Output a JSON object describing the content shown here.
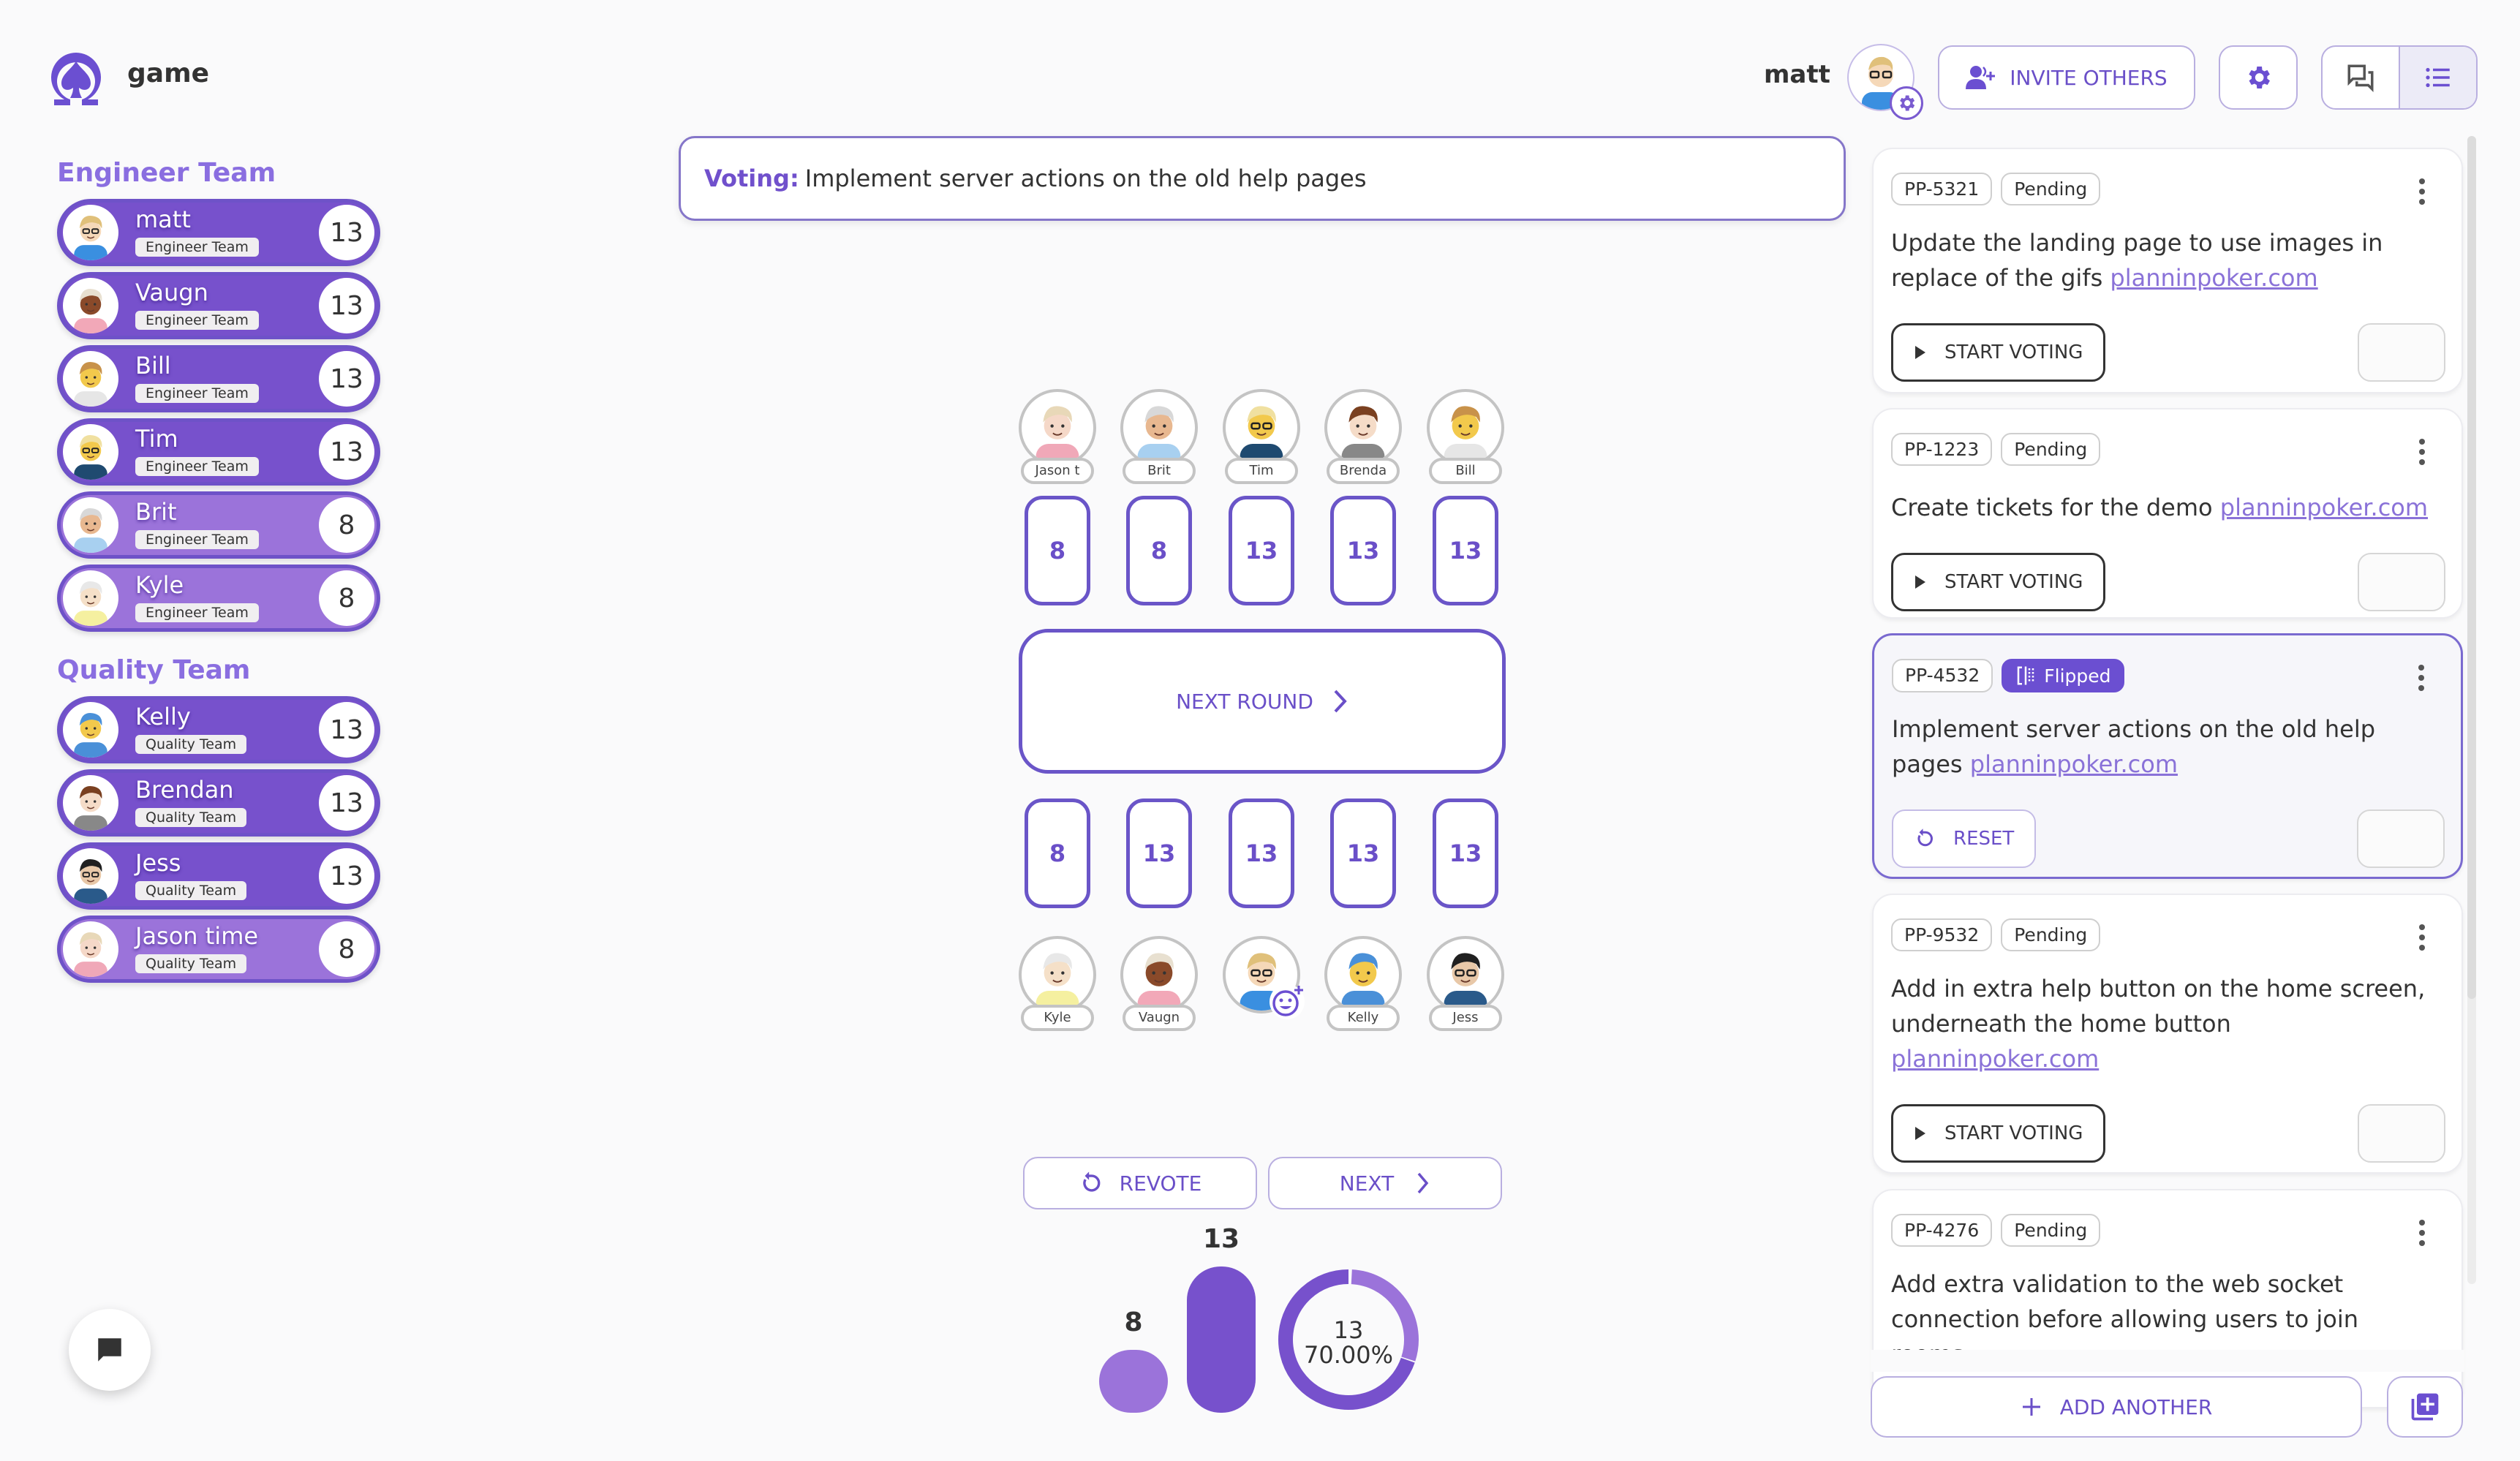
{
  "app": {
    "title": "game",
    "logo_icon": "spade-logo-icon"
  },
  "header": {
    "user_name": "matt",
    "invite_label": "INVITE OTHERS",
    "icons": {
      "invite": "person-add-icon",
      "settings": "gear-icon",
      "chat_view": "chat-bubbles-icon",
      "list_view": "list-icon"
    }
  },
  "colors": {
    "accent": "#6b4fd1",
    "row_voted_majority": "#7751cc",
    "row_voted_minority": "#9b73da",
    "link": "#8a72d8",
    "team_header": "#8a6ee0"
  },
  "sidebar": {
    "teams": [
      {
        "name": "Engineer Team",
        "players": [
          {
            "name": "matt",
            "team": "Engineer Team",
            "vote": "13"
          },
          {
            "name": "Vaugn",
            "team": "Engineer Team",
            "vote": "13"
          },
          {
            "name": "Bill",
            "team": "Engineer Team",
            "vote": "13"
          },
          {
            "name": "Tim",
            "team": "Engineer Team",
            "vote": "13"
          },
          {
            "name": "Brit",
            "team": "Engineer Team",
            "vote": "8"
          },
          {
            "name": "Kyle",
            "team": "Engineer Team",
            "vote": "8"
          }
        ]
      },
      {
        "name": "Quality Team",
        "players": [
          {
            "name": "Kelly",
            "team": "Quality Team",
            "vote": "13"
          },
          {
            "name": "Brendan",
            "team": "Quality Team",
            "vote": "13"
          },
          {
            "name": "Jess",
            "team": "Quality Team",
            "vote": "13"
          },
          {
            "name": "Jason time",
            "team": "Quality Team",
            "vote": "8"
          }
        ]
      }
    ]
  },
  "voting": {
    "label": "Voting:",
    "story": "Implement server actions on the old help pages"
  },
  "table": {
    "top_seats": [
      {
        "name": "Jason t",
        "card": "8"
      },
      {
        "name": "Brit",
        "card": "8"
      },
      {
        "name": "Tim",
        "card": "13"
      },
      {
        "name": "Brenda",
        "card": "13"
      },
      {
        "name": "Bill",
        "card": "13"
      }
    ],
    "bottom_seats": [
      {
        "name": "Kyle",
        "card": "8"
      },
      {
        "name": "Vaugn",
        "card": "13"
      },
      {
        "name": "",
        "card": "13",
        "is_self": true
      },
      {
        "name": "Kelly",
        "card": "13"
      },
      {
        "name": "Jess",
        "card": "13"
      }
    ],
    "next_round_label": "NEXT ROUND"
  },
  "controls": {
    "revote_label": "REVOTE",
    "next_label": "NEXT"
  },
  "chart_data": {
    "type": "bar",
    "title": "",
    "categories": [
      "8",
      "13"
    ],
    "values": [
      3,
      7
    ],
    "ylim": [
      0,
      7
    ],
    "donut": {
      "label": "13",
      "percent_text": "70.00%",
      "slices": [
        {
          "name": "13",
          "value": 70
        },
        {
          "name": "8",
          "value": 30
        }
      ]
    }
  },
  "stories": [
    {
      "id": "PP-5321",
      "status": "Pending",
      "text": "Update the landing page to use images in replace of the gifs",
      "link": "planninpoker.com",
      "action": "START VOTING",
      "active": false
    },
    {
      "id": "PP-1223",
      "status": "Pending",
      "text": "Create tickets for the demo",
      "link": "planninpoker.com",
      "action": "START VOTING",
      "active": false
    },
    {
      "id": "PP-4532",
      "status": "Flipped",
      "text": "Implement server actions on the old help pages",
      "link": "planninpoker.com",
      "action": "RESET",
      "active": true
    },
    {
      "id": "PP-9532",
      "status": "Pending",
      "text": "Add in extra help button on the home screen, underneath the home button",
      "link": "planninpoker.com",
      "action": "START VOTING",
      "active": false
    },
    {
      "id": "PP-4276",
      "status": "Pending",
      "text": "Add extra validation to the web socket connection before allowing users to join rooms",
      "link": "",
      "action": "",
      "active": false
    }
  ],
  "footer": {
    "add_another_label": "ADD ANOTHER"
  }
}
